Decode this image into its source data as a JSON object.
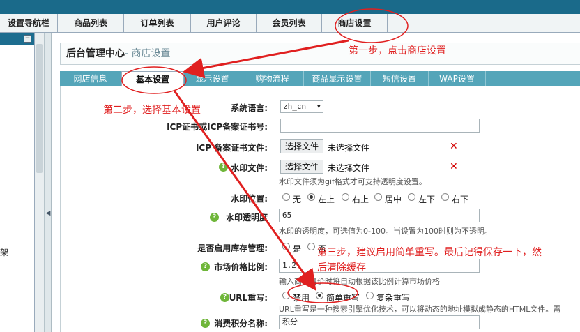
{
  "nav": {
    "items": [
      "设置导航栏",
      "商品列表",
      "订单列表",
      "用户评论",
      "会员列表",
      "商店设置"
    ]
  },
  "sidebar": {
    "collapse_icon": "−",
    "fragment_text": "架"
  },
  "header": {
    "title": "后台管理中心",
    "separator": "- ",
    "subtitle": "商店设置"
  },
  "tabs": [
    "网店信息",
    "基本设置",
    "显示设置",
    "购物流程",
    "商品显示设置",
    "短信设置",
    "WAP设置"
  ],
  "form": {
    "language": {
      "label": "系统语言:",
      "value": "zh_cn"
    },
    "icp": {
      "label": "ICP证书或ICP备案证书号:",
      "value": ""
    },
    "icp_file": {
      "label": "ICP 备案证书文件:",
      "button": "选择文件",
      "status": "未选择文件"
    },
    "watermark_file": {
      "label": "水印文件:",
      "button": "选择文件",
      "status": "未选择文件",
      "note": "水印文件须为gif格式才可支持透明度设置。"
    },
    "watermark_pos": {
      "label": "水印位置:",
      "options": [
        "无",
        "左上",
        "右上",
        "居中",
        "左下",
        "右下"
      ],
      "selected": "左上"
    },
    "watermark_alpha": {
      "label": "水印透明度",
      "value": "65",
      "note": "水印的透明度，可选值为0-100。当设置为100时则为不透明。"
    },
    "stock": {
      "label": "是否启用库存管理:",
      "options": [
        "是",
        "否"
      ]
    },
    "market_price": {
      "label": "市场价格比例:",
      "value": "1.2",
      "note": "输入商品售价时将自动根据该比例计算市场价格"
    },
    "url_rewrite": {
      "label": "URL重写:",
      "options": [
        "禁用",
        "简单重写",
        "复杂重写"
      ],
      "selected": "简单重写",
      "note": "URL重写是一种搜索引擎优化技术，可以将动态的地址模拟成静态的HTML文件。需"
    },
    "points_name": {
      "label": "消费积分名称:",
      "value": "积分"
    }
  },
  "annotations": {
    "step1": "第一步，点击商店设置",
    "step2": "第二步，选择基本设置",
    "step3_line1": "第三步，建议启用简单重写。最后记得保存一下，然",
    "step3_line2": "后清除缓存"
  },
  "colors": {
    "annotation": "#e02020",
    "tab_bar": "#54a5b9",
    "top_strip": "#1a6a8a",
    "help_icon": "#6fb63a",
    "delete_icon": "#d20000"
  },
  "icons": {
    "help": "question-circle-icon",
    "delete": "red-x-icon"
  }
}
